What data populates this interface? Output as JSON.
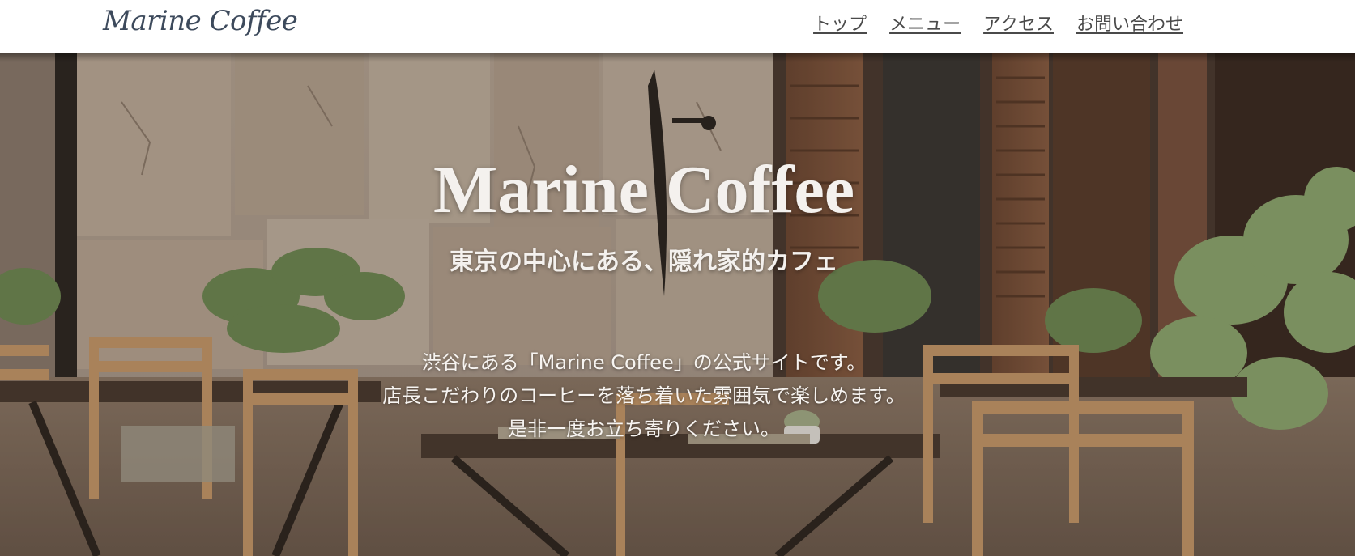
{
  "header": {
    "logo": "Marine Coffee",
    "nav": [
      "トップ",
      "メニュー",
      "アクセス",
      "お問い合わせ"
    ]
  },
  "hero": {
    "title": "Marine Coffee",
    "subtitle": "東京の中心にある、隠れ家的カフェ",
    "lines": [
      "渋谷にある「Marine Coffee」の公式サイトです。",
      "店長こだわりのコーヒーを落ち着いた雰囲気で楽しめます。",
      "是非一度お立ち寄りください。"
    ],
    "image": "cafe-terrace-background"
  },
  "colors": {
    "header_bg": "#ffffff",
    "logo": "#3d4a5c",
    "nav_text": "#4a4a4a",
    "hero_text": "#f4f1ee"
  }
}
